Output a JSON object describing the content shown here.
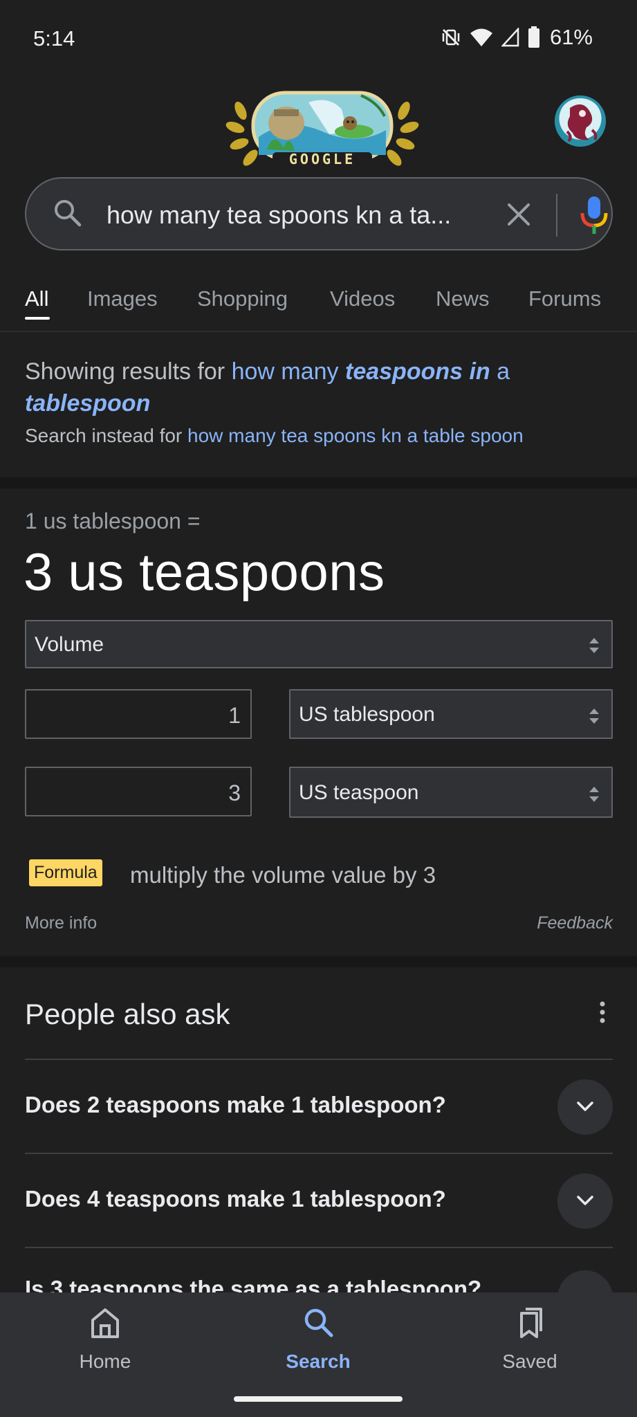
{
  "status_bar": {
    "time": "5:14",
    "battery": "61%"
  },
  "header": {
    "doodle_text": "GOOGLE"
  },
  "search": {
    "query": "how many tea spoons kn a ta..."
  },
  "tabs": [
    {
      "label": "All",
      "active": true
    },
    {
      "label": "Images"
    },
    {
      "label": "Shopping"
    },
    {
      "label": "Videos"
    },
    {
      "label": "News"
    },
    {
      "label": "Forums"
    }
  ],
  "spelling": {
    "prefix": "Showing results for ",
    "part1": "how many ",
    "bold1": "teaspoons in",
    "part2": " a ",
    "bold2": "tablespoon",
    "instead_prefix": "Search instead for ",
    "instead_link": "how many tea spoons kn a table spoon"
  },
  "converter": {
    "equation_top": "1 us tablespoon =",
    "result": "3 us teaspoons",
    "category": "Volume",
    "from_value": "1",
    "from_unit": "US tablespoon",
    "to_value": "3",
    "to_unit": "US teaspoon",
    "formula_label": "Formula",
    "formula_text": "multiply the volume value by 3",
    "more_info": "More info",
    "feedback": "Feedback"
  },
  "people_also_ask": {
    "title": "People also ask",
    "questions": [
      "Does 2 teaspoons make 1 tablespoon?",
      "Does 4 teaspoons make 1 tablespoon?",
      "Is 3 teaspoons the same as a tablespoon?"
    ]
  },
  "bottom_nav": {
    "items": [
      {
        "label": "Home",
        "icon": "home-icon"
      },
      {
        "label": "Search",
        "icon": "search-icon",
        "active": true
      },
      {
        "label": "Saved",
        "icon": "saved-icon"
      }
    ]
  },
  "colors": {
    "background": "#1f1f1f",
    "link": "#8ab4f8",
    "formula_badge": "#fdd663",
    "surface": "#303134"
  }
}
